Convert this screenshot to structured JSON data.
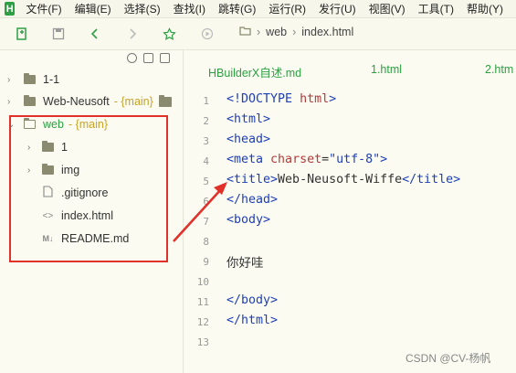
{
  "menu": {
    "logo": "H",
    "items": [
      "文件(F)",
      "编辑(E)",
      "选择(S)",
      "查找(I)",
      "跳转(G)",
      "运行(R)",
      "发行(U)",
      "视图(V)",
      "工具(T)",
      "帮助(Y)"
    ]
  },
  "breadcrumb": {
    "folder": "web",
    "file": "index.html"
  },
  "sidebar": {
    "items": [
      {
        "label": "1-1",
        "branch": ""
      },
      {
        "label": "Web-Neusoft",
        "branch": "- {main}"
      },
      {
        "label": "web",
        "branch": "- {main}"
      },
      {
        "label": "1",
        "branch": ""
      },
      {
        "label": "img",
        "branch": ""
      },
      {
        "label": ".gitignore",
        "branch": ""
      },
      {
        "label": "index.html",
        "branch": ""
      },
      {
        "label": "README.md",
        "branch": ""
      }
    ]
  },
  "tabs": [
    "HBuilderX自述.md",
    "1.html",
    "2.htm"
  ],
  "editor": {
    "line_numbers": [
      "1",
      "2",
      "3",
      "4",
      "5",
      "6",
      "7",
      "8",
      "9",
      "10",
      "11",
      "12",
      "13"
    ],
    "doctype": "<!DOCTYPE ",
    "doctype_attr": "html",
    "doctype_end": ">",
    "html_open": "<html>",
    "head_open": "<head>",
    "meta_open": "<meta ",
    "meta_attr": "charset",
    "meta_eq": "=",
    "meta_val": "\"utf-8\"",
    "meta_close": ">",
    "title_open": "<title>",
    "title_text": "Web-Neusoft-Wiffe",
    "title_close": "</title>",
    "head_close": "</head>",
    "body_open": "<body>",
    "body_text": "你好哇",
    "body_close": "</body>",
    "html_close": "</html>"
  },
  "watermark": "CSDN @CV-杨帆",
  "colors": {
    "accent": "#2ea043",
    "annotation": "#e0312b",
    "tag": "#1f3fb8",
    "attribute": "#b23b3b"
  }
}
